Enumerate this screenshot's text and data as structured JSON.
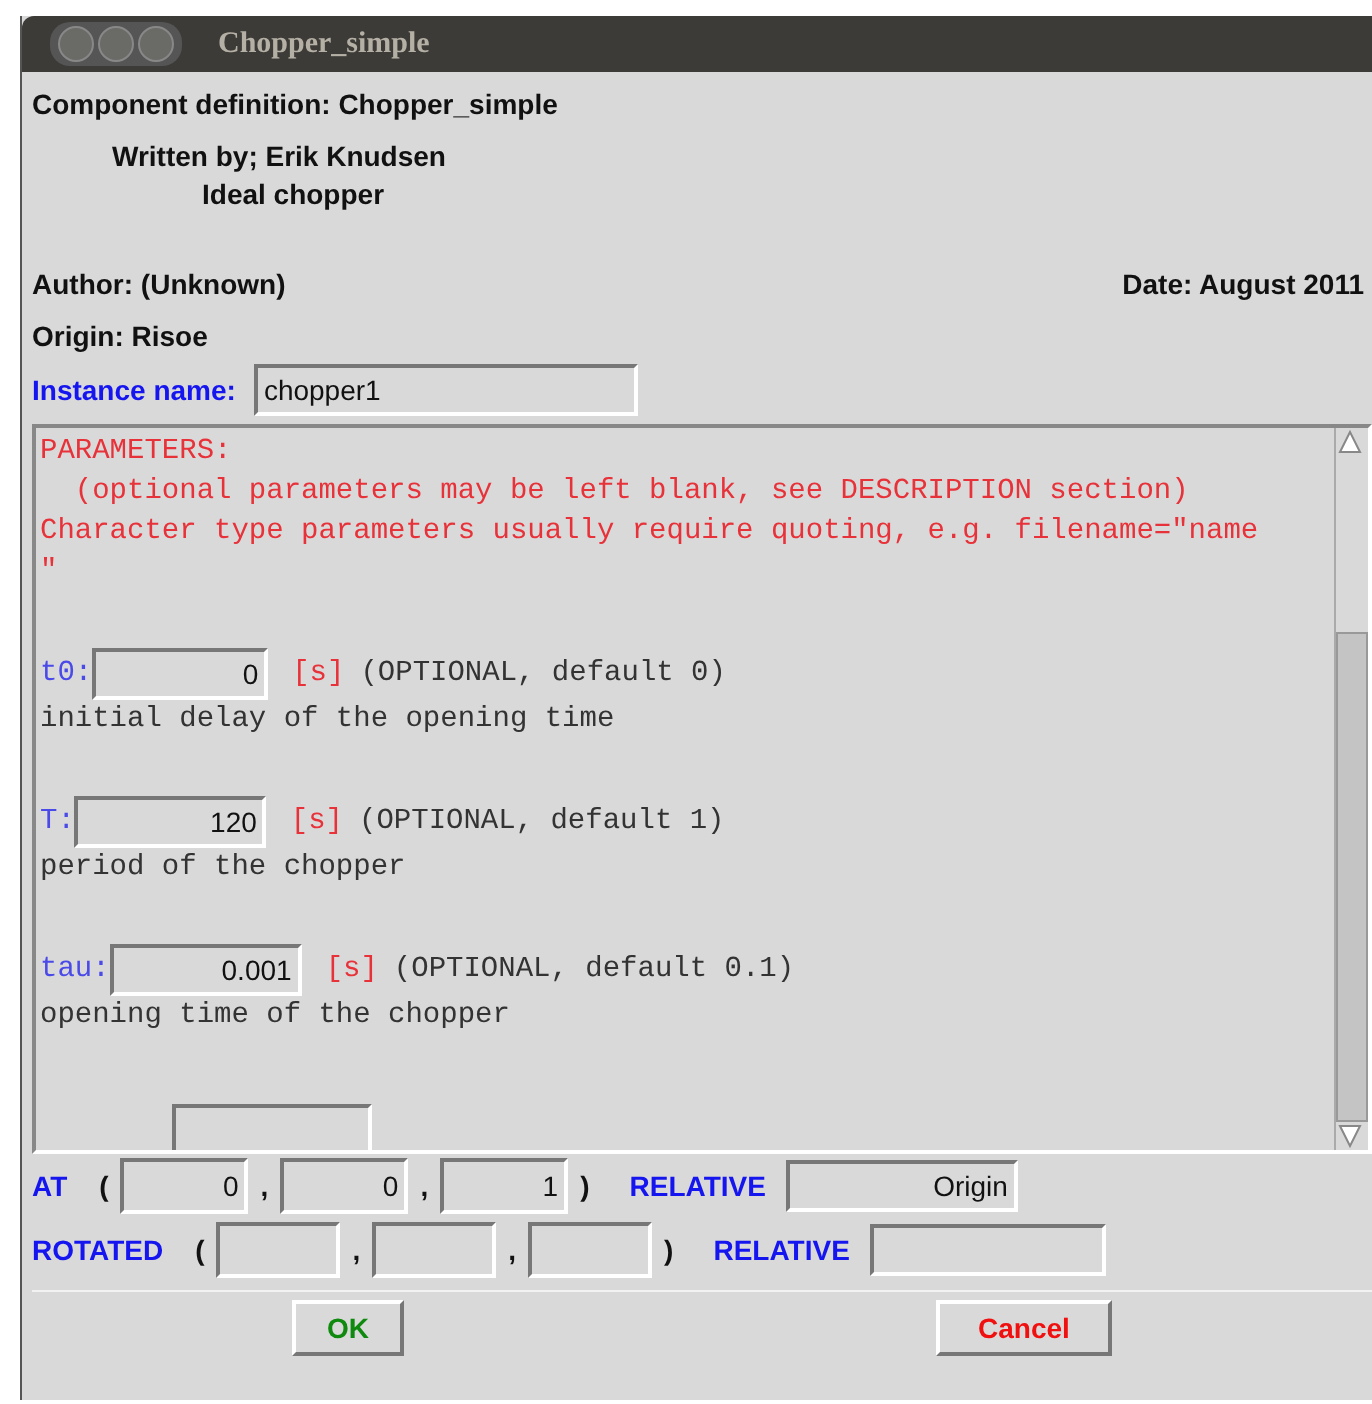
{
  "window": {
    "title": "Chopper_simple"
  },
  "header": {
    "definition": "Component definition: Chopper_simple",
    "written_by": "Written by; Erik Knudsen",
    "description": "Ideal chopper",
    "author": "Author: (Unknown)",
    "date": "Date:  August 2011",
    "origin": "Origin:  Risoe"
  },
  "instance": {
    "label": "Instance name:",
    "value": "chopper1"
  },
  "parameters_header": [
    "PARAMETERS:",
    "  (optional parameters may be left blank, see DESCRIPTION section)",
    "Character type parameters usually require quoting, e.g. filename=\"name",
    "\""
  ],
  "parameters": [
    {
      "name": "t0:",
      "value": "0",
      "unit": "[s]",
      "note": "(OPTIONAL, default 0)",
      "description": "initial delay of the opening time"
    },
    {
      "name": "T:",
      "value": "120",
      "unit": "[s]",
      "note": "(OPTIONAL, default 1)",
      "description": "period of the chopper"
    },
    {
      "name": "tau:",
      "value": "0.001",
      "unit": "[s]",
      "note": "(OPTIONAL, default 0.1)",
      "description": "opening time of the chopper"
    }
  ],
  "at": {
    "label": "AT",
    "open": "(",
    "values": [
      "0",
      "0",
      "1"
    ],
    "sep": ",",
    "close": ")",
    "relative_label": "RELATIVE",
    "relative": "Origin"
  },
  "rotated": {
    "label": "ROTATED",
    "open": "(",
    "sep": ",",
    "close": ")",
    "relative_label": "RELATIVE"
  },
  "buttons": [
    {
      "label": "OK",
      "kind": "ok"
    },
    {
      "label": "Cancel",
      "kind": "cancel"
    }
  ]
}
